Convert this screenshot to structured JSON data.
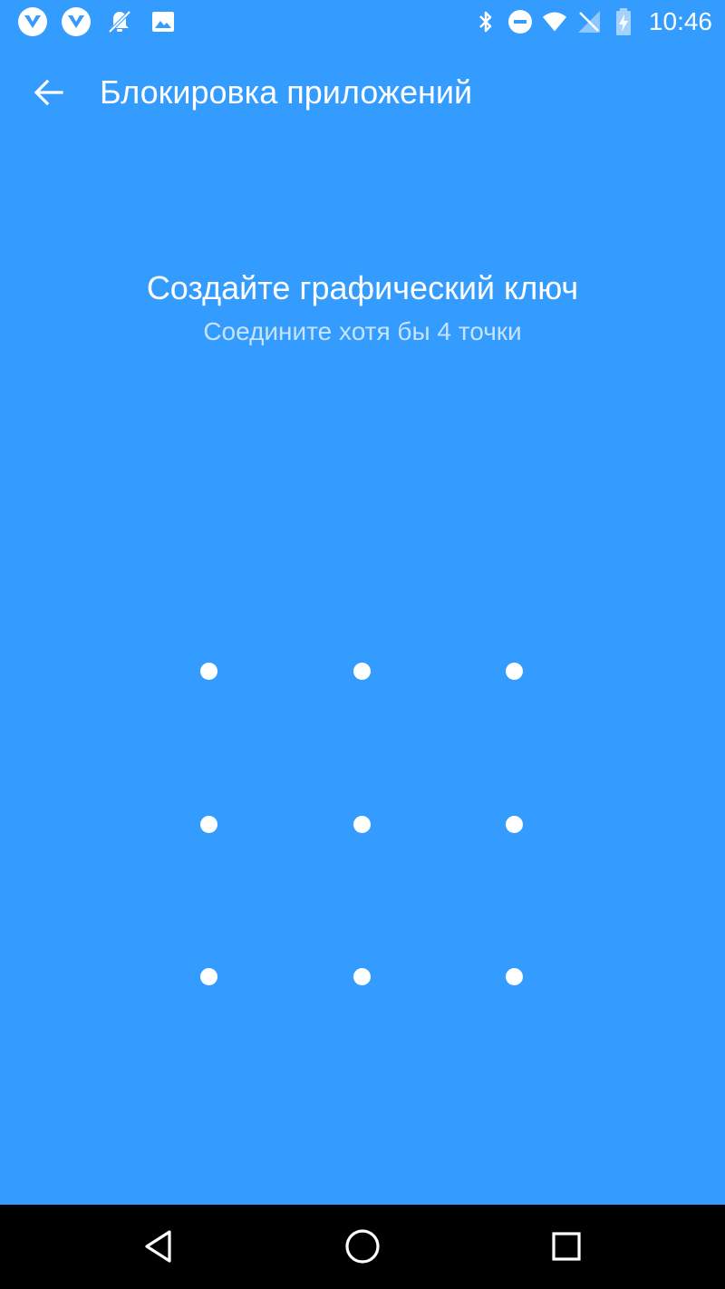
{
  "status_bar": {
    "time": "10:46",
    "left_icons": [
      "app-notification-icon",
      "app-notification-icon",
      "notification-off-icon",
      "image-icon"
    ],
    "right_icons": [
      "bluetooth-icon",
      "do-not-disturb-icon",
      "wifi-icon",
      "no-signal-icon",
      "battery-charging-icon"
    ]
  },
  "toolbar": {
    "title": "Блокировка приложений",
    "back_icon": "arrow-back-icon"
  },
  "pattern_setup": {
    "heading": "Создайте графический ключ",
    "subheading": "Соедините хотя бы 4 точки",
    "grid_rows": 3,
    "grid_cols": 3
  },
  "nav_bar": {
    "buttons": [
      "back-triangle-icon",
      "home-circle-icon",
      "recents-square-icon"
    ]
  },
  "colors": {
    "background": "#349cfe",
    "foreground": "#ffffff",
    "nav_background": "#000000"
  }
}
